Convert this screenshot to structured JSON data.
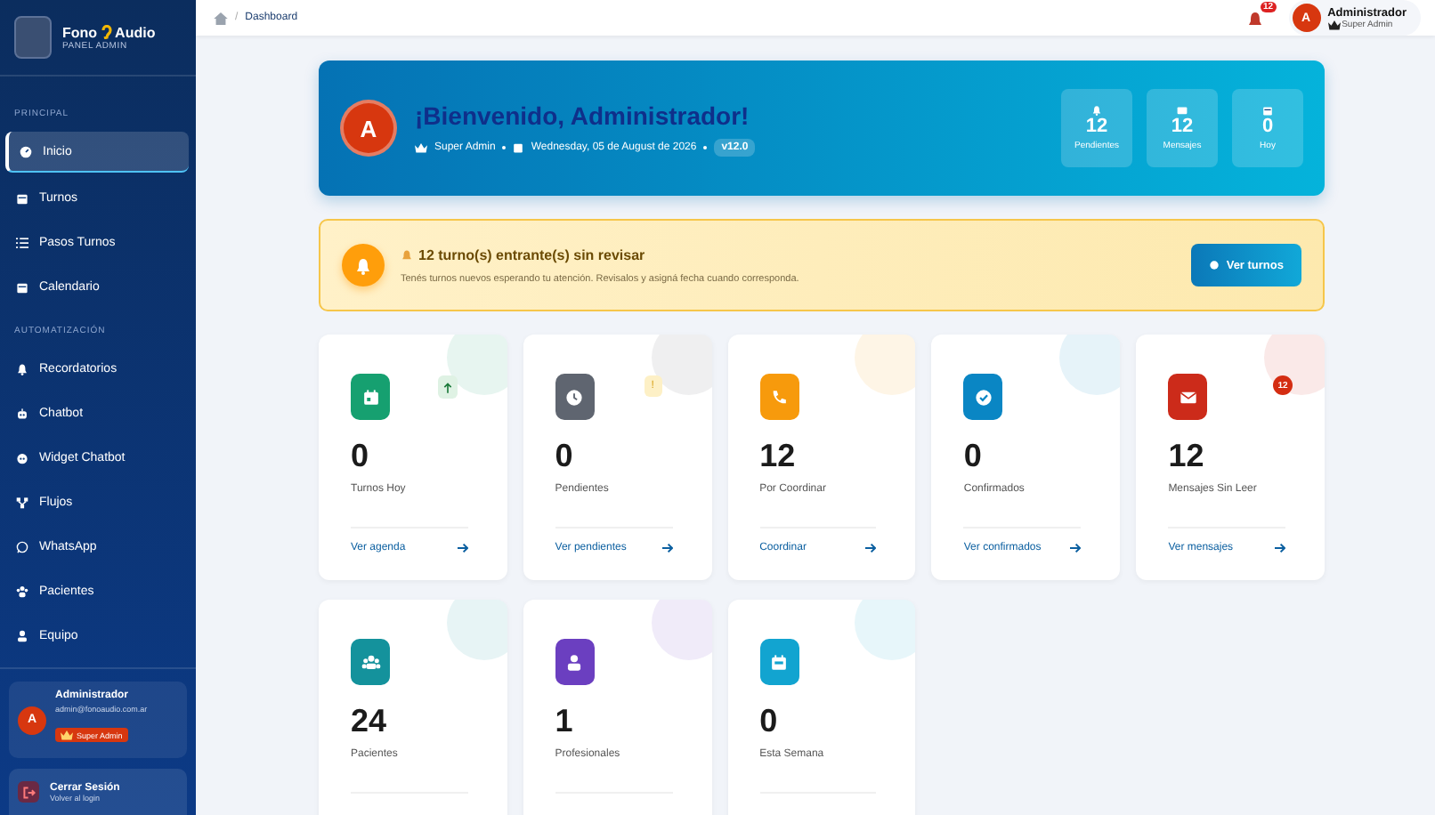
{
  "sidebar": {
    "brand": {
      "name_left": "Fono",
      "name_right": "Audio",
      "subtitle": "PANEL ADMIN"
    },
    "sections": [
      {
        "title": "PRINCIPAL",
        "items": [
          {
            "label": "Inicio",
            "selected": true
          },
          {
            "label": "Turnos",
            "selected": false
          },
          {
            "label": "Pasos Turnos",
            "selected": false
          },
          {
            "label": "Calendario",
            "selected": false
          }
        ]
      },
      {
        "title": "AUTOMATIZACIÓN",
        "items": [
          {
            "label": "Recordatorios",
            "selected": false
          },
          {
            "label": "Chatbot",
            "selected": false
          },
          {
            "label": "Widget Chatbot",
            "selected": false
          },
          {
            "label": "Flujos",
            "selected": false
          },
          {
            "label": "WhatsApp",
            "selected": false
          },
          {
            "label": "Pacientes",
            "selected": false
          },
          {
            "label": "Equipo",
            "selected": false
          }
        ]
      }
    ],
    "user": {
      "avatar": "A",
      "name": "Administrador",
      "email": "admin@fonoaudio.com.ar",
      "role": "Super Admin"
    },
    "logout": {
      "label": "Cerrar Sesión",
      "hint": "Volver al login"
    }
  },
  "topbar": {
    "separator": "/",
    "breadcrumb": "Dashboard",
    "notifications": "12",
    "user": {
      "avatar": "A",
      "name": "Administrador",
      "role": "Super Admin"
    }
  },
  "hero": {
    "avatar": "A",
    "title": "¡Bienvenido, Administrador!",
    "role": "Super Admin",
    "date": "Wednesday, 05 de August de 2026",
    "version": "v12.0",
    "stats": [
      {
        "value": "12",
        "label": "Pendientes"
      },
      {
        "value": "12",
        "label": "Mensajes"
      },
      {
        "value": "0",
        "label": "Hoy"
      }
    ]
  },
  "alert": {
    "title": "12 turno(s) entrante(s) sin revisar",
    "message": "Tenés turnos nuevos esperando tu atención. Revisalos y asigná fecha cuando corresponda.",
    "button": "Ver turnos"
  },
  "cards": [
    {
      "value": "0",
      "label": "Turnos Hoy",
      "link": "Ver agenda",
      "color": "#16a070",
      "badge": {
        "kind": "arrow"
      }
    },
    {
      "value": "0",
      "label": "Pendientes",
      "link": "Ver pendientes",
      "color": "#5f6570",
      "badge": {
        "kind": "warning",
        "text": "!"
      }
    },
    {
      "value": "12",
      "label": "Por Coordinar",
      "link": "Coordinar",
      "color": "#f79a0c"
    },
    {
      "value": "0",
      "label": "Confirmados",
      "link": "Ver confirmados",
      "color": "#0a86c4"
    },
    {
      "value": "12",
      "label": "Mensajes Sin Leer",
      "link": "Ver mensajes",
      "color": "#cc2b1a",
      "badge": {
        "kind": "count",
        "text": "12"
      }
    },
    {
      "value": "24",
      "label": "Pacientes",
      "color": "#14929c"
    },
    {
      "value": "1",
      "label": "Profesionales",
      "color": "#6b3fc0"
    },
    {
      "value": "0",
      "label": "Esta Semana",
      "color": "#12a4d0"
    }
  ]
}
